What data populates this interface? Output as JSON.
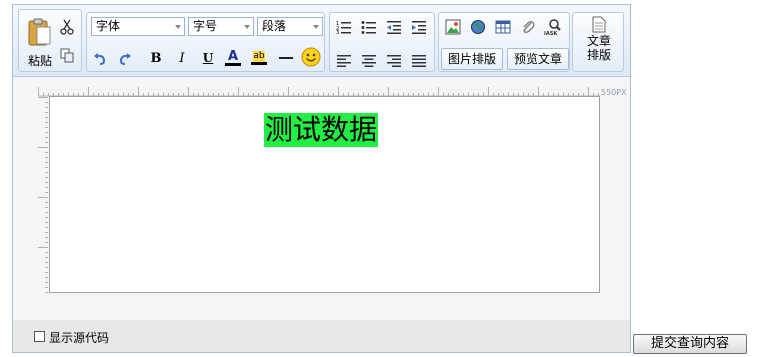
{
  "toolbar": {
    "paste_label": "粘贴",
    "font_family": "字体",
    "font_size": "字号",
    "paragraph": "段落",
    "image_layout_label": "图片排版",
    "preview_label": "预览文章",
    "article_layout_line1": "文章",
    "article_layout_line2": "排版",
    "bold_label": "B",
    "italic_label": "I",
    "underline_label": "U",
    "font_color_label": "A",
    "highlight_label": "ab"
  },
  "editor": {
    "content": "测试数据",
    "width_label": "550PX",
    "highlight_color": "#22ee44"
  },
  "footer": {
    "show_source_label": "显示源代码",
    "show_source_checked": false
  },
  "submit_label": "提交查询内容"
}
